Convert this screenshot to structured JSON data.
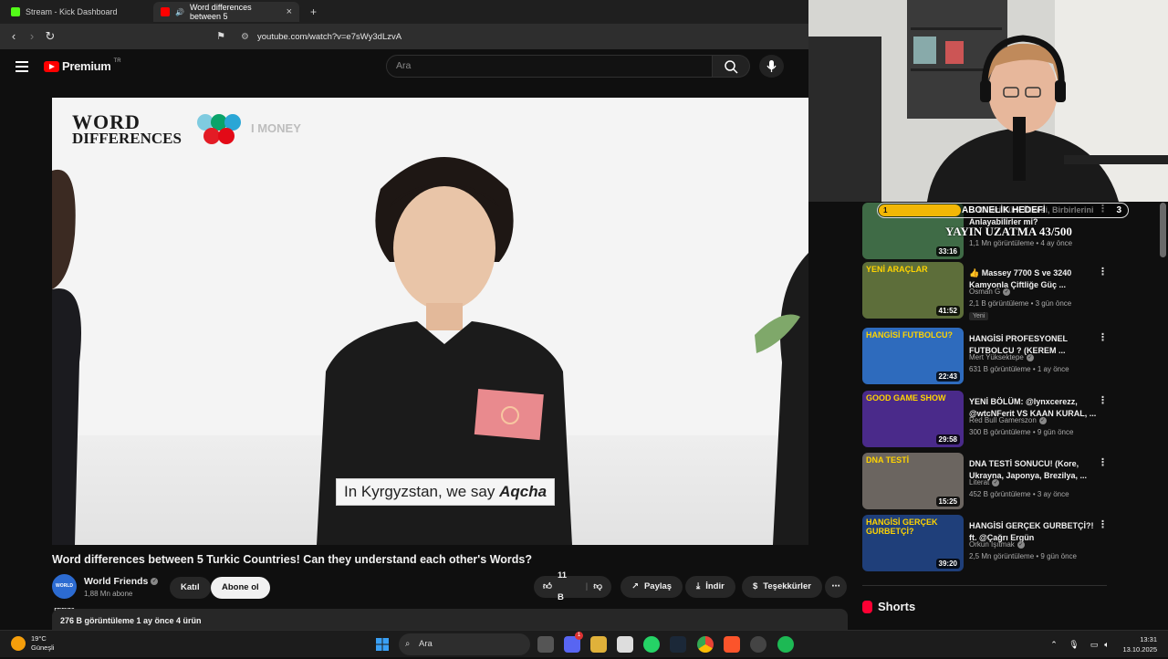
{
  "browser": {
    "tabs": [
      {
        "label": "Stream - Kick Dashboard",
        "active": false,
        "favicon_color": "#53fc18"
      },
      {
        "label": "Word differences between 5",
        "active": true,
        "favicon_color": "#ff0000"
      }
    ],
    "url": "youtube.com/watch?v=e7sWy3dLzvA"
  },
  "youtube": {
    "logo_text": "Premium",
    "logo_country": "TR",
    "search_placeholder": "Ara",
    "video": {
      "brand_line1": "WORD",
      "brand_line2": "DIFFERENCES",
      "brand_line3": "I MONEY",
      "caption_prefix": "In Kyrgyzstan, we say ",
      "caption_word": "Aqcha"
    },
    "title": "Word differences between 5 Turkic Countries! Can they understand each other's Words?",
    "channel": {
      "avatar_text": "WORLD FRIENDS",
      "name": "World Friends",
      "subscribers": "1,88 Mn abone",
      "join_label": "Katıl",
      "subscribe_label": "Abone ol"
    },
    "actions": {
      "likes": "11 B",
      "share": "Paylaş",
      "download": "İndir",
      "thanks": "Teşekkürler",
      "more": "⋯"
    },
    "description_meta": "276 B görüntüleme   1 ay önce   4 ürün",
    "recommendations": [
      {
        "title": "... Dilleri Türk Ülkesi, Birbirlerini Anlayabilirler mi?",
        "channel": "",
        "meta": "1,1 Mn görüntüleme • 4 ay önce",
        "duration": "33:16",
        "thumb_color": "#3f6b46",
        "thumb_text": ""
      },
      {
        "title": "👍 Massey 7700 S ve 3240 Kamyonla Çiftliğe Güç ...",
        "channel": "Osman G",
        "meta": "2,1 B görüntüleme • 3 gün önce",
        "duration": "41:52",
        "badge": "Yeni",
        "thumb_color": "#5d6e3a",
        "thumb_text": "YENİ ARAÇLAR"
      },
      {
        "title": "HANGİSİ PROFESYONEL FUTBOLCU ? (KEREM ...",
        "channel": "Mert Yüksektepe",
        "meta": "631 B görüntüleme • 1 ay önce",
        "duration": "22:43",
        "thumb_color": "#2e6bbd",
        "thumb_text": "HANGİSİ FUTBOLCU?"
      },
      {
        "title": "YENİ BÖLÜM: @lynxcerezz, @wtcNFerit VS KAAN KURAL, ...",
        "channel": "Red Bull Gamerszon",
        "meta": "300 B görüntüleme • 9 gün önce",
        "duration": "29:58",
        "thumb_color": "#4a2a8a",
        "thumb_text": "GOOD GAME SHOW"
      },
      {
        "title": "DNA TESTİ SONUCU! (Kore, Ukrayna, Japonya, Brezilya, ...",
        "channel": "Literat",
        "meta": "452 B görüntüleme • 3 ay önce",
        "duration": "15:25",
        "thumb_color": "#6b6560",
        "thumb_text": "DNA TESTİ"
      },
      {
        "title": "HANGİSİ GERÇEK GURBETÇİ?! ft. @Çağrı Ergün",
        "channel": "Orkun Işıtmak",
        "meta": "2,5 Mn görüntüleme • 9 gün önce",
        "duration": "39:20",
        "thumb_color": "#1f3f7a",
        "thumb_text": "HANGİSİ GERÇEK GURBETÇİ?"
      }
    ],
    "shorts_label": "Shorts"
  },
  "stream_overlay": {
    "goal_number": "1",
    "goal_label": "ABONELİK HEDEFİ",
    "goal_count": "3",
    "extension_text": "YAYIN UZATMA 43/500"
  },
  "taskbar": {
    "weather_temp": "19°C",
    "weather_desc": "Güneşli",
    "search_label": "Ara",
    "time": "13:31",
    "date": "13.10.2025",
    "discord_badge": "1"
  }
}
